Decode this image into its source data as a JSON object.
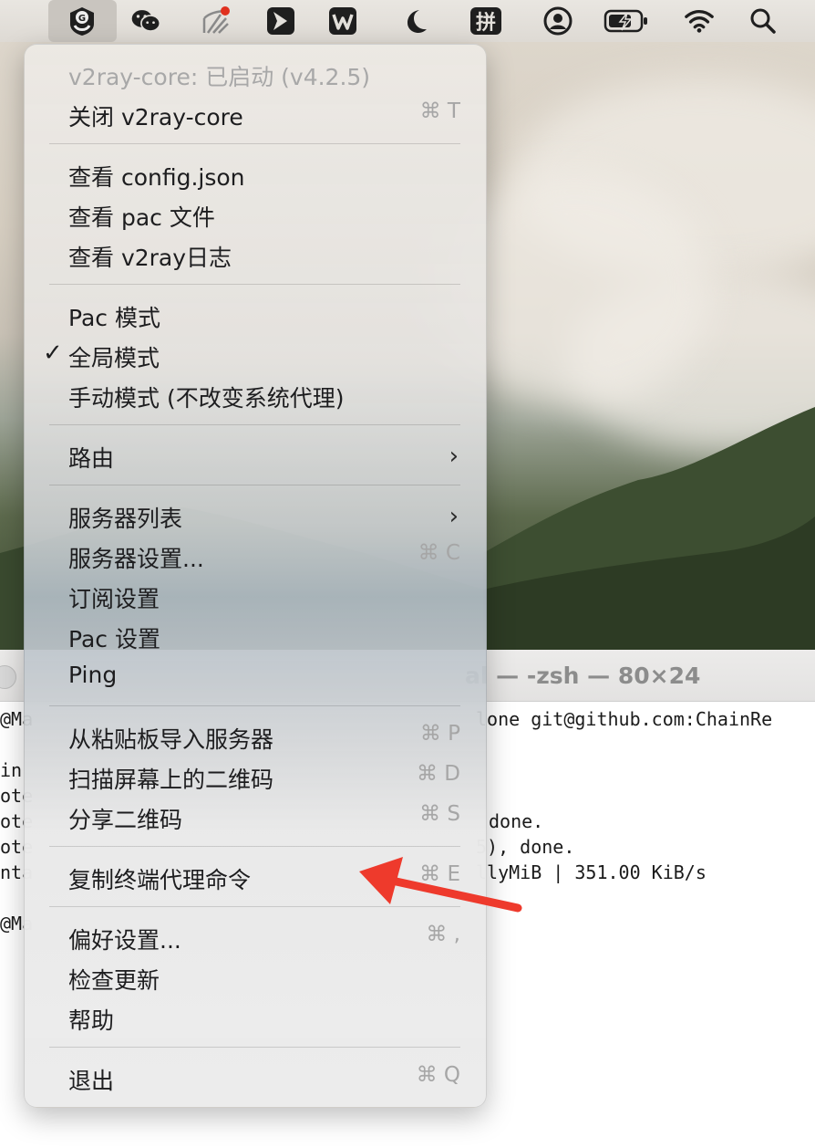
{
  "menubar": {
    "icons": [
      "v2rayu-icon",
      "wechat-icon",
      "network-icon",
      "feishu-icon",
      "wps-icon",
      "moon-icon",
      "input-method-icon",
      "user-icon",
      "battery-icon",
      "wifi-icon",
      "search-icon"
    ],
    "input_method_label": "拼",
    "notification_dot_color": "#e0301e"
  },
  "terminal": {
    "title": "al — -zsh — 80×24",
    "lines": [
      "@Ma",
      "lone git@github.com:ChainRe",
      "in",
      "ote",
      "ote",
      "done.",
      "ote",
      "5), done.",
      "nta",
      "llyMiB | 351.00 KiB/s",
      "@Ma"
    ]
  },
  "menu": {
    "status": "v2ray-core: 已启动  (v4.2.5)",
    "items": [
      {
        "label": "关闭 v2ray-core",
        "shortcut": "⌘ T"
      },
      {
        "label": "查看 config.json",
        "shortcut": ""
      },
      {
        "label": "查看 pac 文件",
        "shortcut": ""
      },
      {
        "label": "查看 v2ray日志",
        "shortcut": ""
      },
      {
        "label": "Pac 模式",
        "shortcut": ""
      },
      {
        "label": "全局模式",
        "shortcut": "",
        "checked": true
      },
      {
        "label": "手动模式 (不改变系统代理)",
        "shortcut": ""
      },
      {
        "label": "路由",
        "submenu": true
      },
      {
        "label": "服务器列表",
        "submenu": true
      },
      {
        "label": "服务器设置...",
        "shortcut": "⌘ C"
      },
      {
        "label": "订阅设置",
        "shortcut": ""
      },
      {
        "label": "Pac 设置",
        "shortcut": ""
      },
      {
        "label": "Ping",
        "shortcut": ""
      },
      {
        "label": "从粘贴板导入服务器",
        "shortcut": "⌘ P"
      },
      {
        "label": "扫描屏幕上的二维码",
        "shortcut": "⌘ D"
      },
      {
        "label": "分享二维码",
        "shortcut": "⌘ S"
      },
      {
        "label": "复制终端代理命令",
        "shortcut": "⌘ E"
      },
      {
        "label": "偏好设置...",
        "shortcut": "⌘ ,"
      },
      {
        "label": "检查更新",
        "shortcut": ""
      },
      {
        "label": "帮助",
        "shortcut": ""
      },
      {
        "label": "退出",
        "shortcut": "⌘ Q"
      }
    ],
    "checkmark": "✓",
    "chevron": "›"
  },
  "annotation": {
    "arrow_color": "#ee3a2c"
  }
}
